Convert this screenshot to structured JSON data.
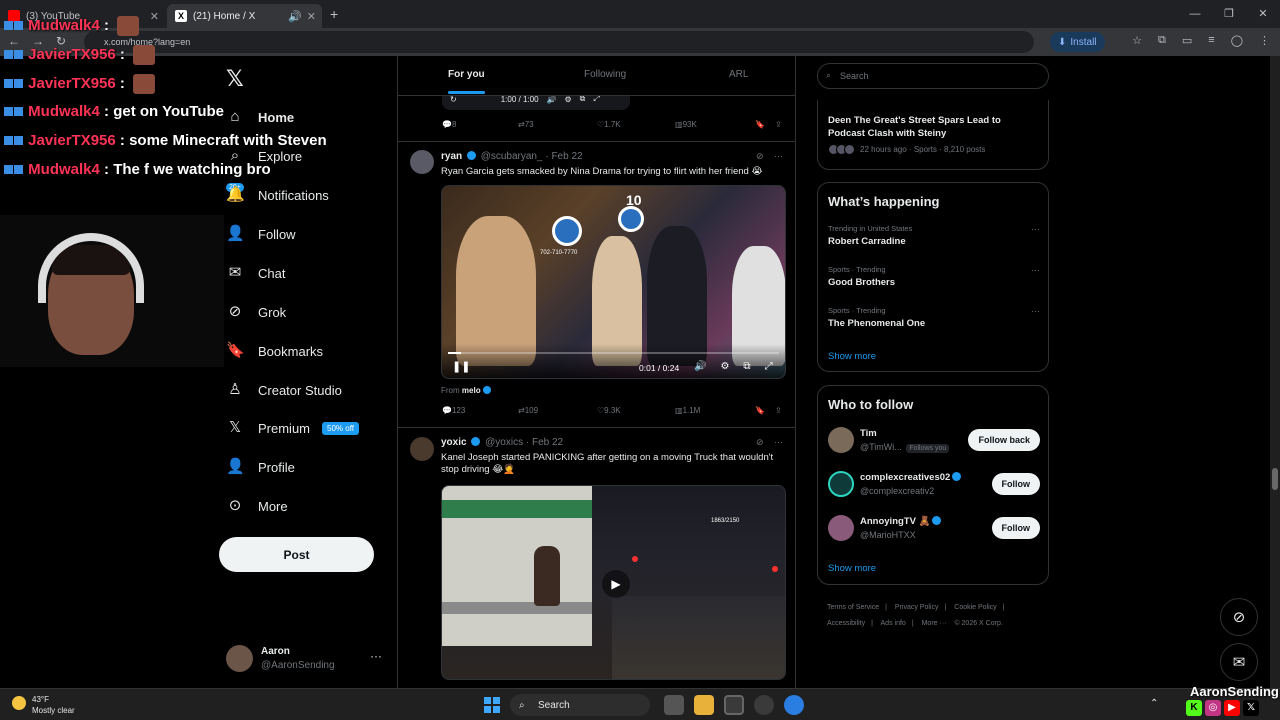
{
  "browser": {
    "tabs": [
      {
        "title": "(3) YouTube",
        "favicon_color": "#ff0000"
      },
      {
        "title": "(21) Home / X",
        "favicon_color": "#ffffff"
      }
    ],
    "url": "x.com/home?lang=en",
    "install_label": "Install"
  },
  "stream_chat": [
    {
      "user": "Mudwalk4",
      "sep": ":",
      "msg": ""
    },
    {
      "user": "JavierTX956",
      "sep": ":",
      "msg": ""
    },
    {
      "user": "JavierTX956",
      "sep": ":",
      "msg": ""
    },
    {
      "user": "Mudwalk4",
      "sep": ":",
      "msg": "get on YouTube"
    },
    {
      "user": "JavierTX956",
      "sep": ":",
      "msg": "some Minecraft with Steven"
    },
    {
      "user": "Mudwalk4",
      "sep": ":",
      "msg": "The f we watching bro"
    }
  ],
  "nav": {
    "items": [
      {
        "label": "Home",
        "icon": "home-icon"
      },
      {
        "label": "Explore",
        "icon": "search-icon"
      },
      {
        "label": "Notifications",
        "icon": "bell-icon"
      },
      {
        "label": "Follow",
        "icon": "follow-icon"
      },
      {
        "label": "Chat",
        "icon": "mail-icon"
      },
      {
        "label": "Grok",
        "icon": "grok-icon"
      },
      {
        "label": "Bookmarks",
        "icon": "bookmark-icon"
      },
      {
        "label": "Creator Studio",
        "icon": "creator-icon"
      },
      {
        "label": "Premium",
        "icon": "x-icon"
      },
      {
        "label": "Profile",
        "icon": "person-icon"
      },
      {
        "label": "More",
        "icon": "more-icon"
      }
    ],
    "notif_count": "20+",
    "premium_badge": "50% off",
    "post_label": "Post",
    "account": {
      "name": "Aaron",
      "handle": "@AaronSending"
    }
  },
  "timeline": {
    "tabs": [
      "For you",
      "Following",
      "ARL"
    ],
    "prev_player": {
      "time": "1:00 / 1:00"
    },
    "prev_actions": {
      "replies": "8",
      "reposts": "73",
      "likes": "1.7K",
      "views": "93K"
    },
    "tweets": [
      {
        "name": "ryan",
        "handle": "@scubaryan_",
        "date": "Feb 22",
        "text": "Ryan Garcia gets smacked by Nina Drama for trying to flirt with her friend 😭",
        "video_time": "0:01 / 0:24",
        "video_progress": 0.04,
        "store_number": "10",
        "store_phone": "702-710-7770",
        "from_label": "From",
        "from_user": "melo",
        "actions": {
          "replies": "123",
          "reposts": "109",
          "likes": "9.3K",
          "views": "1.1M"
        }
      },
      {
        "name": "yoxic",
        "handle": "@yoxics",
        "date": "Feb 22",
        "text": "Kanel Joseph started PANICKING after getting on a moving Truck that wouldn't stop driving 😂🤦",
        "overlay_count": "1863/2150"
      }
    ]
  },
  "sidebar": {
    "search_placeholder": "Search",
    "story": {
      "title": "Deen The Great's Street Spars Lead to Podcast Clash with Steiny",
      "meta": "22 hours ago · Sports · 8,210 posts"
    },
    "happening_title": "What’s happening",
    "trends": [
      {
        "context": "Trending in United States",
        "title": "Robert Carradine"
      },
      {
        "context": "Sports · Trending",
        "title": "Good Brothers"
      },
      {
        "context": "Sports · Trending",
        "title": "The Phenomenal One"
      }
    ],
    "show_more": "Show more",
    "wtf_title": "Who to follow",
    "wtf": [
      {
        "name": "Tim",
        "handle": "@TimWi...",
        "follows_you": "Follows you",
        "button": "Follow back",
        "verified": false
      },
      {
        "name": "complexcreatives02",
        "handle": "@complexcreativ2",
        "follows_you": "",
        "button": "Follow",
        "verified": true
      },
      {
        "name": "AnnoyingTV 🧸",
        "handle": "@MarioHTXX",
        "follows_you": "",
        "button": "Follow",
        "verified": true
      }
    ],
    "footer": [
      "Terms of Service",
      "|",
      "Privacy Policy",
      "|",
      "Cookie Policy",
      "|",
      "Accessibility",
      "|",
      "Ads info",
      "|",
      "More ···",
      "© 2026 X Corp."
    ]
  },
  "taskbar": {
    "weather_temp": "43°F",
    "weather_desc": "Mostly clear",
    "search_label": "Search"
  },
  "overlay_brand": "AaronSending"
}
